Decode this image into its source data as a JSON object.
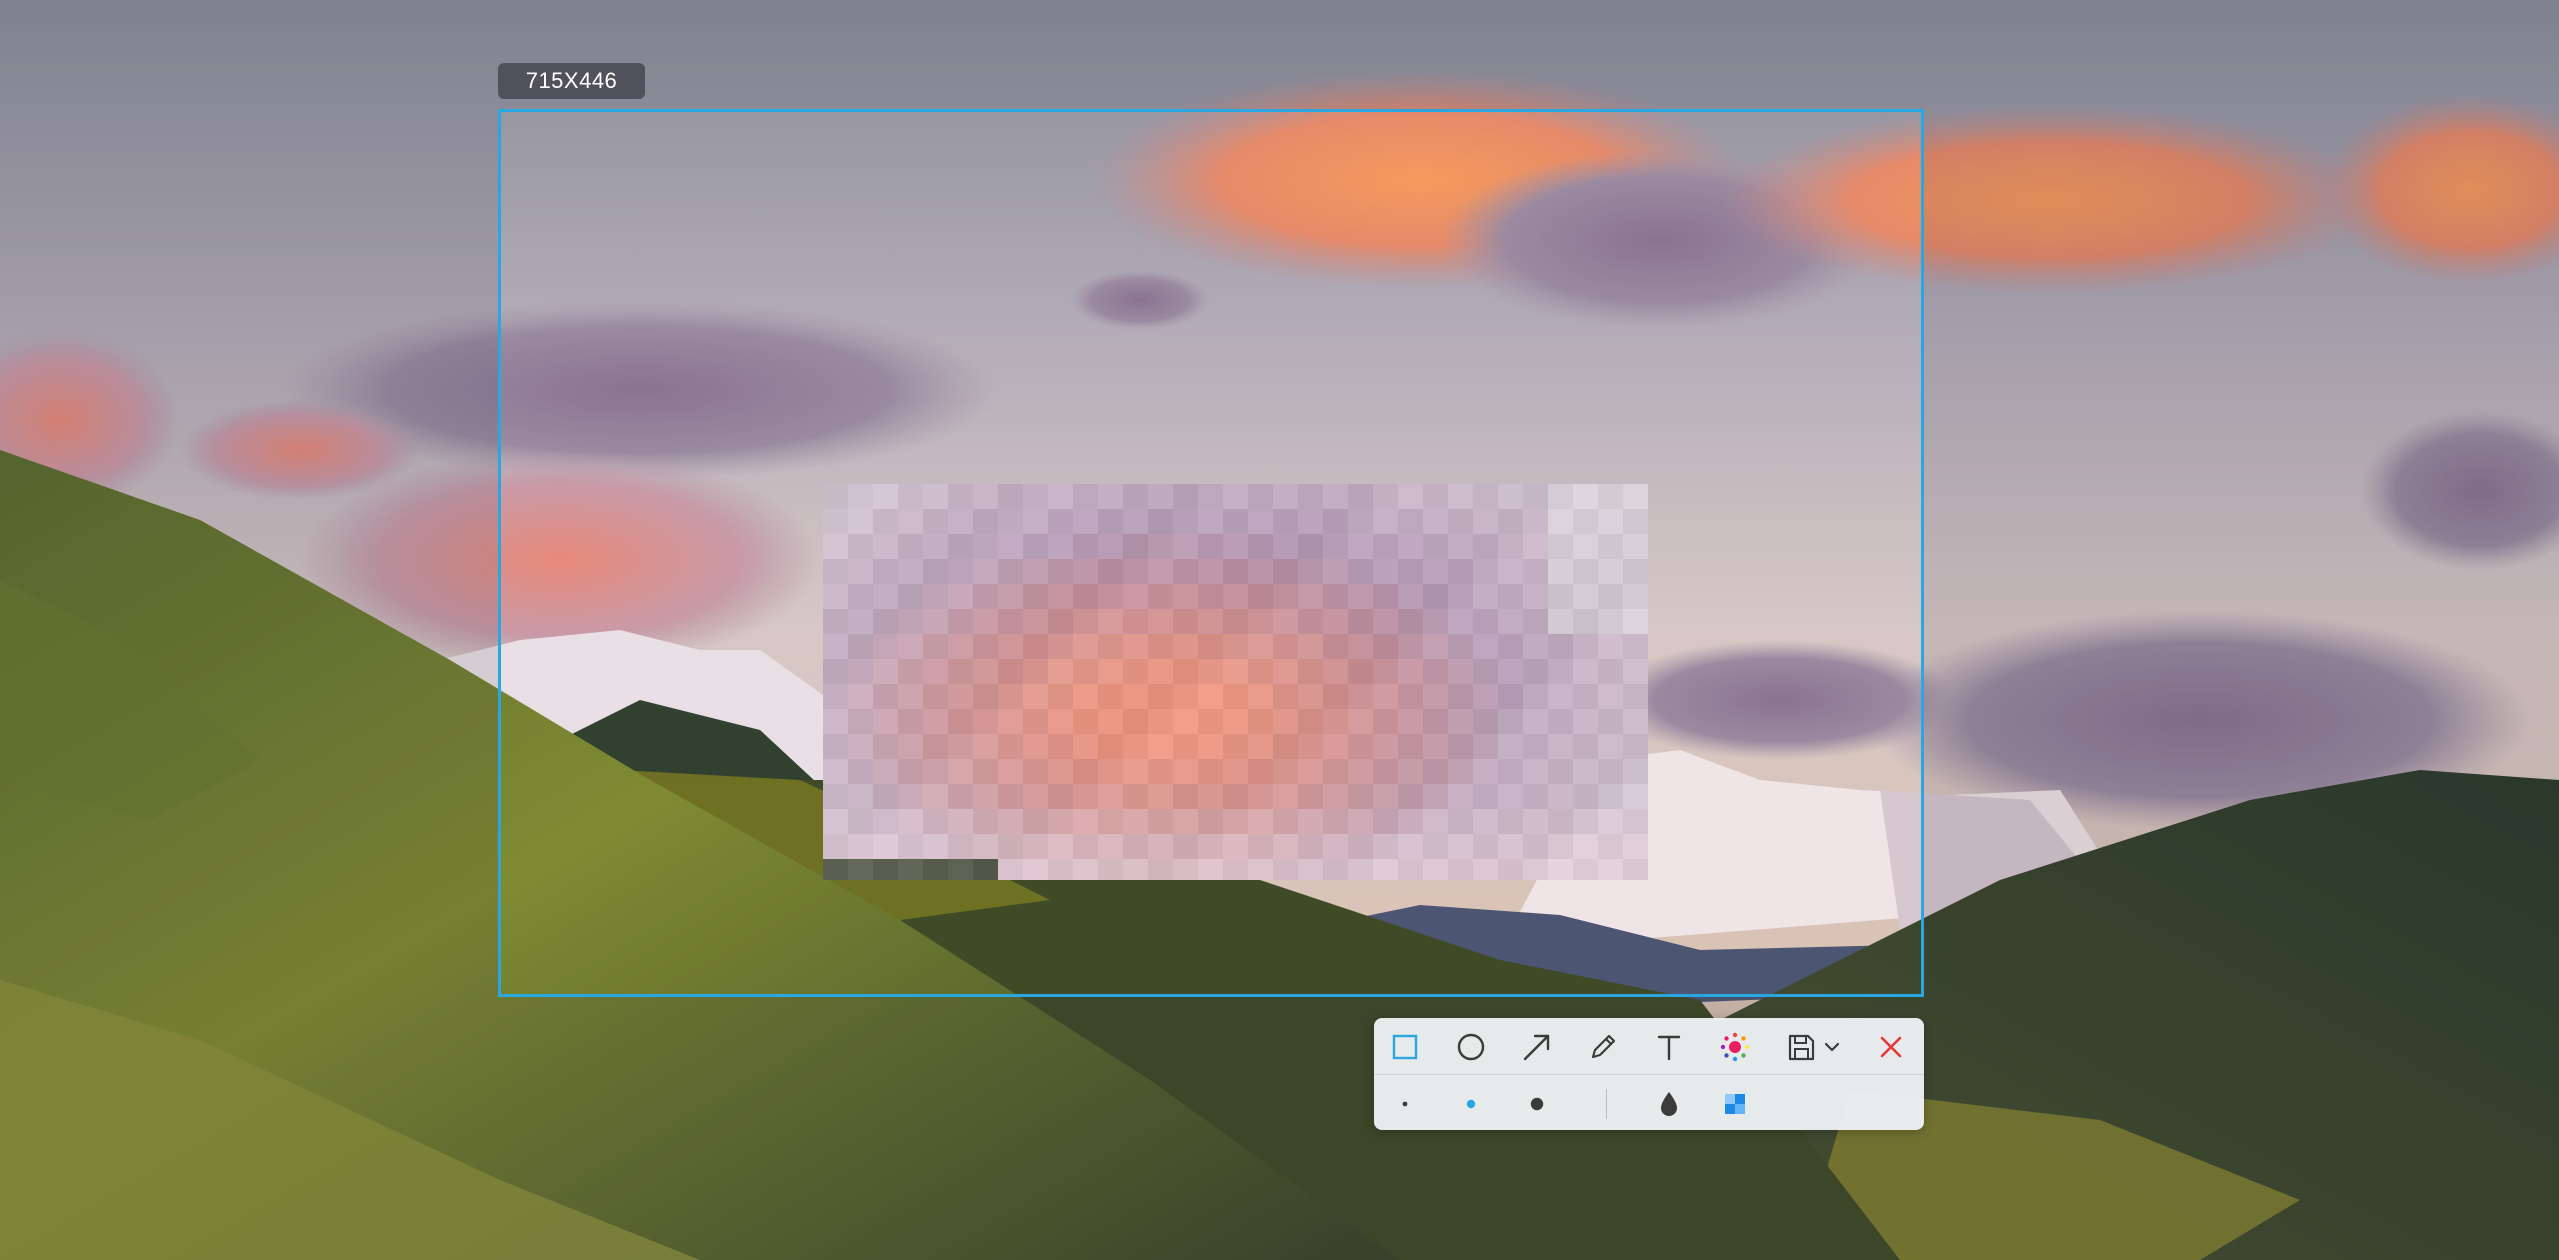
{
  "selection": {
    "size_label": "715X446",
    "border_color": "#2aa7e0"
  },
  "toolbar": {
    "tools": [
      {
        "name": "rectangle-icon",
        "active": true
      },
      {
        "name": "ellipse-icon",
        "active": false
      },
      {
        "name": "arrow-icon",
        "active": false
      },
      {
        "name": "pencil-icon",
        "active": false
      },
      {
        "name": "text-icon",
        "active": false
      },
      {
        "name": "color-picker-icon",
        "active": false
      },
      {
        "name": "save-icon",
        "active": false
      },
      {
        "name": "chevron-down-icon",
        "active": false
      },
      {
        "name": "close-icon",
        "active": false
      }
    ],
    "options": [
      {
        "name": "brush-size-small-icon",
        "active": false
      },
      {
        "name": "brush-size-medium-icon",
        "active": true
      },
      {
        "name": "brush-size-large-icon",
        "active": false
      },
      {
        "name": "blur-drop-icon",
        "active": false
      },
      {
        "name": "mosaic-icon",
        "active": false
      }
    ],
    "colors": {
      "accent": "#2aa7e0",
      "icon": "#3b3b3b",
      "close": "#e53935"
    }
  }
}
